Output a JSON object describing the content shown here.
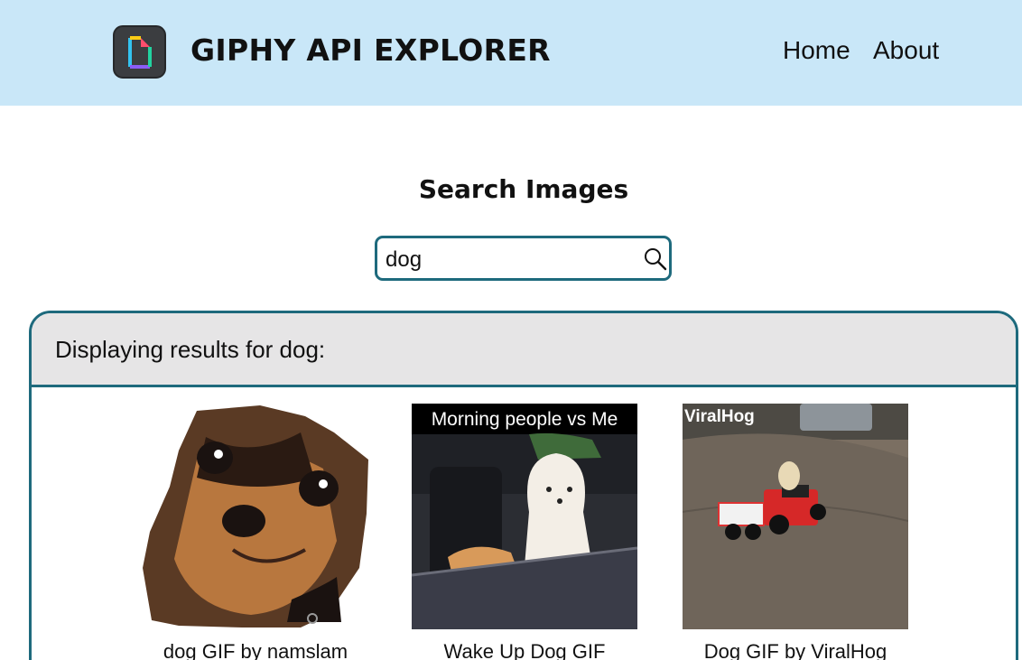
{
  "header": {
    "title": "GIPHY API EXPLORER",
    "logo_icon": "giphy-logo-icon",
    "nav": [
      {
        "label": "Home"
      },
      {
        "label": "About"
      }
    ],
    "background": "#c9e7f8"
  },
  "search": {
    "heading": "Search Images",
    "value": "dog",
    "icon": "search-icon",
    "accent": "#1e6a7d"
  },
  "results": {
    "title": "Displaying results for dog:",
    "header_background": "#e6e5e6",
    "items": [
      {
        "caption": "dog GIF by namslam"
      },
      {
        "caption": "Wake Up Dog GIF",
        "overlay_text": "Morning people vs Me"
      },
      {
        "caption": "Dog GIF by ViralHog",
        "watermark": "ViralHog"
      }
    ]
  }
}
